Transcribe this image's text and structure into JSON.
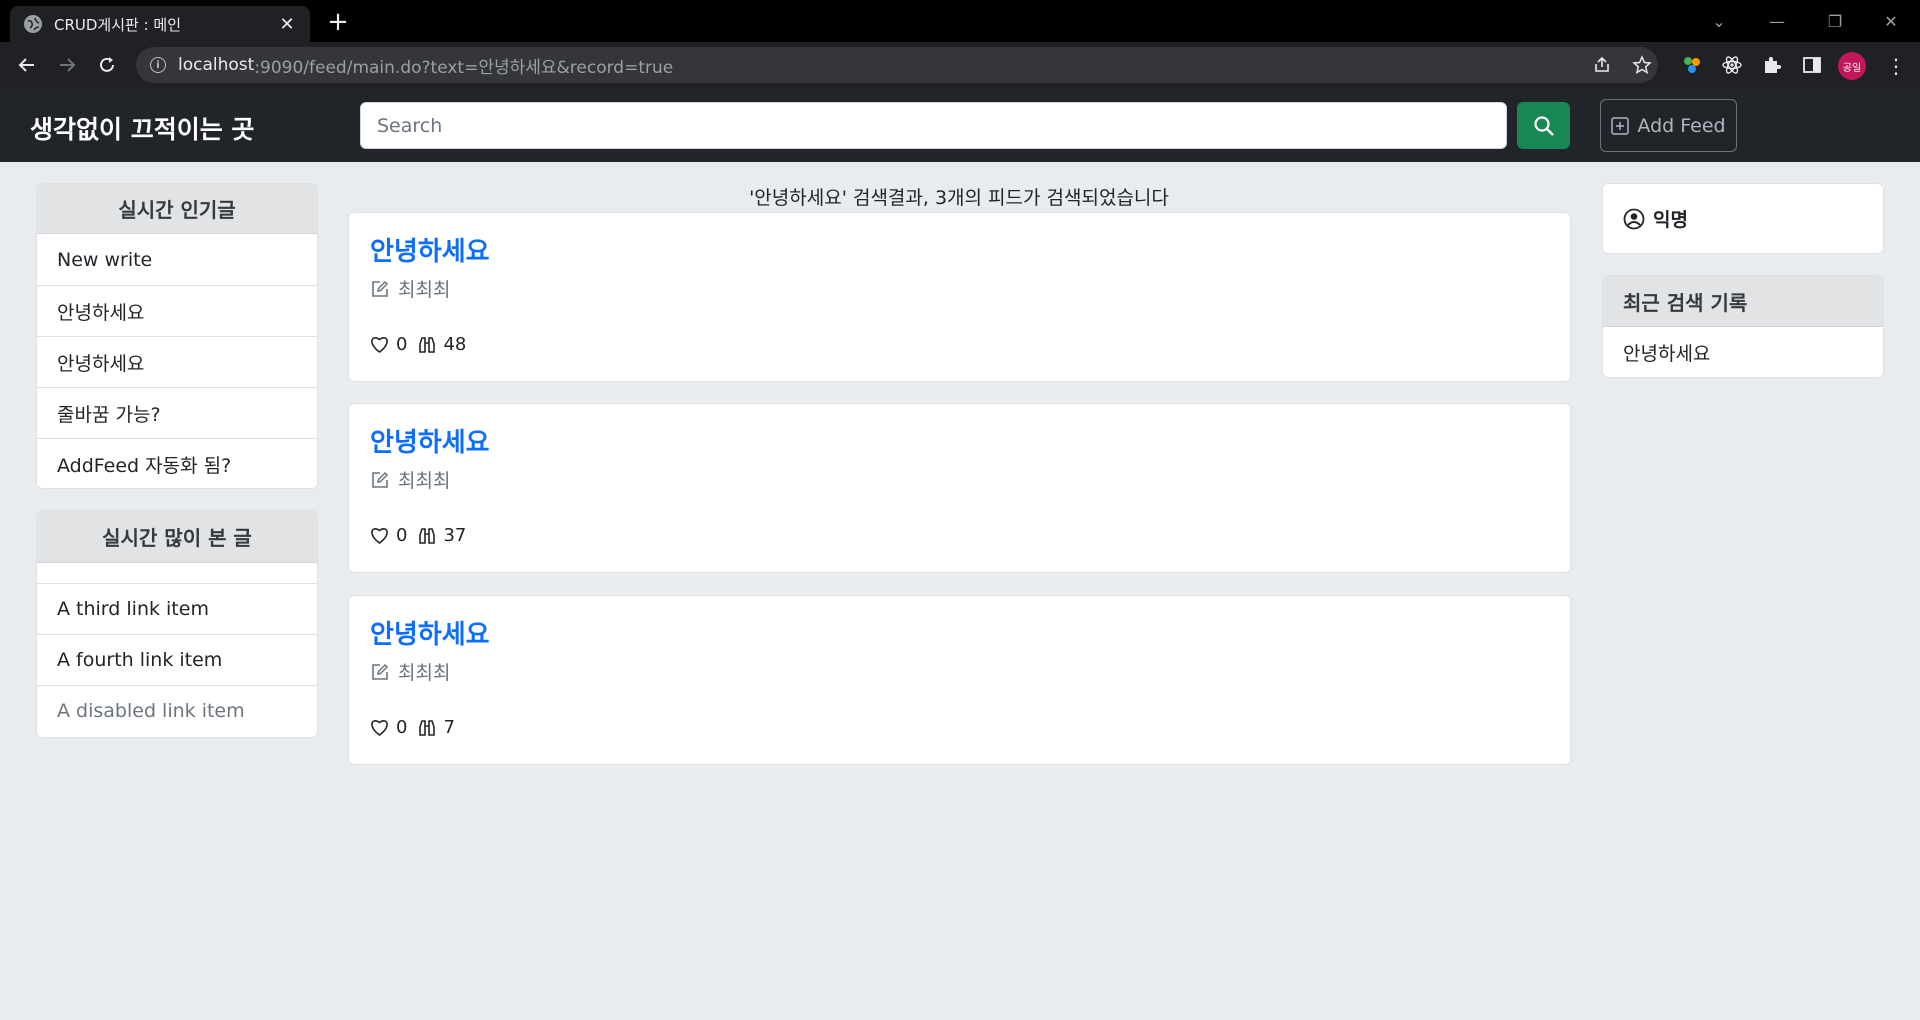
{
  "browser": {
    "tab_title": "CRUD게시판 : 메인",
    "url_host": "localhost",
    "url_rest": ":9090/feed/main.do?text=안녕하세요&record=true",
    "profile_label": "공일"
  },
  "navbar": {
    "brand": "생각없이 끄적이는 곳",
    "search_placeholder": "Search",
    "add_feed_label": "Add Feed",
    "search_button_color": "#198754"
  },
  "left_sidebar": {
    "popular": {
      "header": "실시간 인기글",
      "items": [
        "New write",
        "안녕하세요",
        "안녕하세요",
        "줄바꿈 가능?",
        "AddFeed 자동화 됨?"
      ]
    },
    "most_viewed": {
      "header": "실시간 많이 본 글",
      "items": [
        "",
        "A third link item",
        "A fourth link item",
        "A disabled link item"
      ]
    }
  },
  "main": {
    "result_message": "'안녕하세요' 검색결과, 3개의 피드가 검색되었습니다",
    "feeds": [
      {
        "title": "안녕하세요",
        "author": "최최최",
        "likes": "0",
        "views": "48"
      },
      {
        "title": "안녕하세요",
        "author": "최최최",
        "likes": "0",
        "views": "37"
      },
      {
        "title": "안녕하세요",
        "author": "최최최",
        "likes": "0",
        "views": "7"
      }
    ]
  },
  "right_sidebar": {
    "user_name": "익명",
    "recent_header": "최근 검색 기록",
    "recent_items": [
      "안녕하세요"
    ]
  },
  "colors": {
    "link_blue": "#0d6efd",
    "navbar_bg": "#212529",
    "page_bg": "#e9ecef"
  }
}
